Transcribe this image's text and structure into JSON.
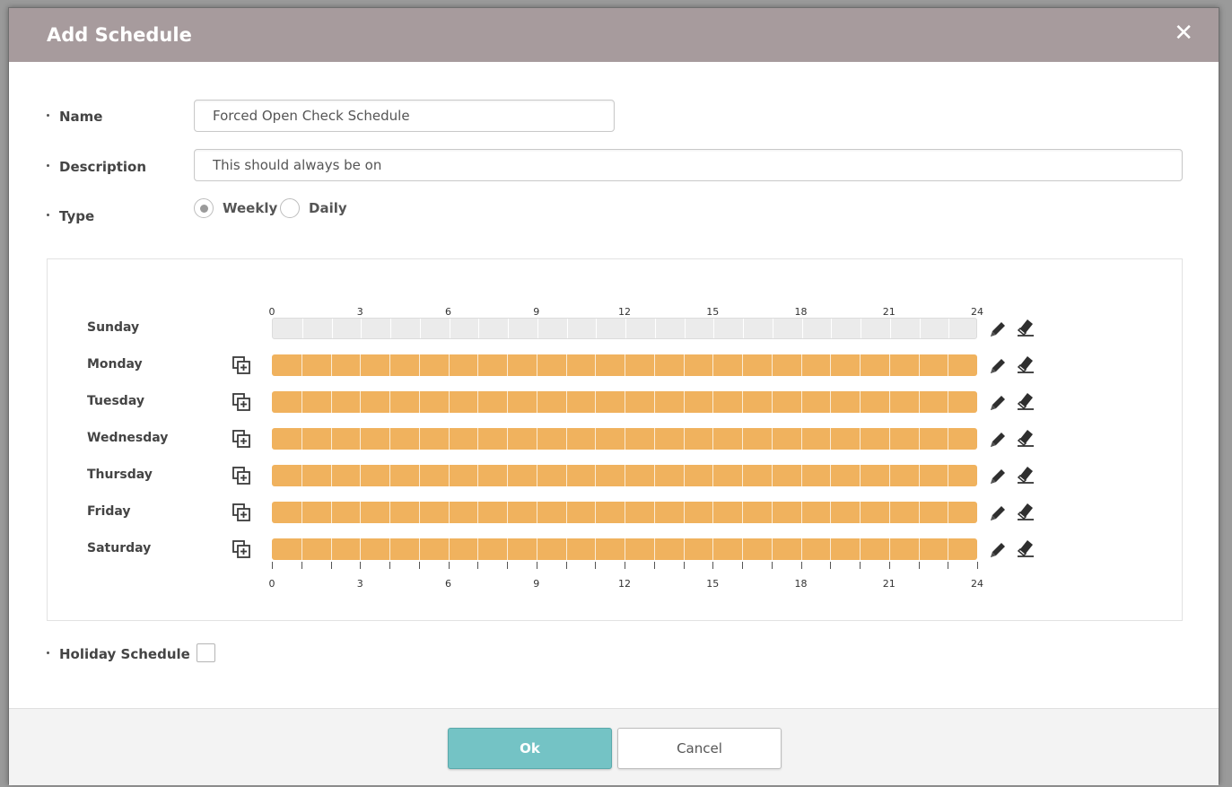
{
  "dialog": {
    "title": "Add Schedule",
    "close_glyph": "✕"
  },
  "form": {
    "name_label": "Name",
    "name_value": "Forced Open Check Schedule",
    "description_label": "Description",
    "description_value": "This should always be on",
    "type_label": "Type",
    "type_options": [
      {
        "label": "Weekly",
        "selected": true
      },
      {
        "label": "Daily",
        "selected": false
      }
    ]
  },
  "schedule": {
    "hour_ticks": [
      "0",
      "3",
      "6",
      "9",
      "12",
      "15",
      "18",
      "21",
      "24"
    ],
    "days": [
      {
        "name": "Sunday",
        "active": false,
        "copy_icon": false
      },
      {
        "name": "Monday",
        "active": true,
        "copy_icon": true
      },
      {
        "name": "Tuesday",
        "active": true,
        "copy_icon": true
      },
      {
        "name": "Wednesday",
        "active": true,
        "copy_icon": true
      },
      {
        "name": "Thursday",
        "active": true,
        "copy_icon": true
      },
      {
        "name": "Friday",
        "active": true,
        "copy_icon": true
      },
      {
        "name": "Saturday",
        "active": true,
        "copy_icon": true
      }
    ],
    "active_color": "#f0b25e",
    "inactive_color": "#ebebeb",
    "row_icons": [
      "copy-icon",
      "pencil-icon",
      "eraser-icon"
    ]
  },
  "holiday": {
    "label": "Holiday Schedule",
    "checked": false
  },
  "footer": {
    "ok_label": "Ok",
    "cancel_label": "Cancel"
  }
}
